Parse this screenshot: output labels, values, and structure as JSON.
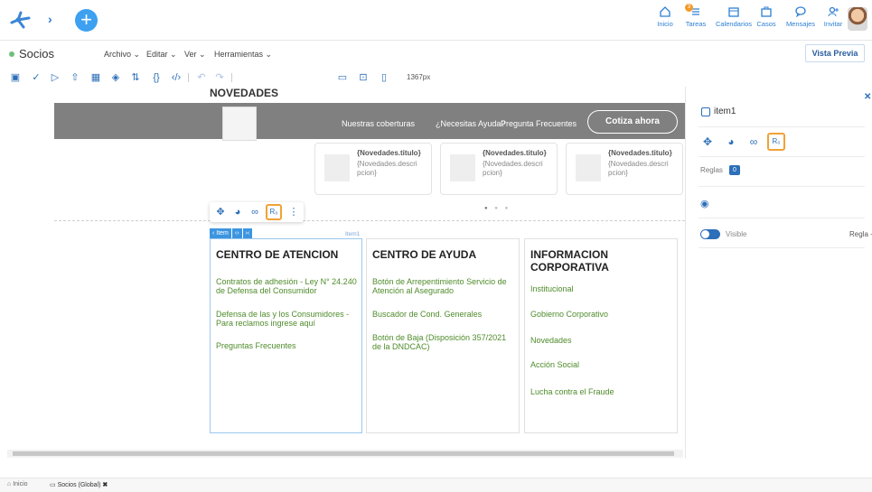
{
  "topnav": {
    "items": [
      {
        "label": "Inicio",
        "icon": "home-icon"
      },
      {
        "label": "Tareas",
        "icon": "tasks-icon",
        "badge": "3"
      },
      {
        "label": "Calendarios",
        "icon": "calendar-icon"
      },
      {
        "label": "Casos",
        "icon": "briefcase-icon"
      },
      {
        "label": "Mensajes",
        "icon": "chat-icon"
      },
      {
        "label": "Invitar",
        "icon": "add-user-icon"
      }
    ]
  },
  "menubar": {
    "title": "Socios",
    "menus": [
      "Archivo ⌄",
      "Editar ⌄",
      "Ver ⌄",
      "Herramientas ⌄"
    ],
    "preview_button": "Vista Previa"
  },
  "toolbar": {
    "width_label": "1367px"
  },
  "canvas": {
    "heading": "NOVEDADES",
    "band_links": [
      "Nuestras coberturas",
      "¿Necesitas Ayuda?",
      "Pregunta Frecuentes"
    ],
    "cta": "Cotiza ahora",
    "cards": [
      {
        "title": "{Novedades.titulo}",
        "desc": "{Novedades.descri pcion}"
      },
      {
        "title": "{Novedades.titulo}",
        "desc": "{Novedades.descri pcion}"
      },
      {
        "title": "{Novedades.titulo}",
        "desc": "{Novedades.descri pcion}"
      }
    ],
    "item_tag": "‹ Item",
    "item_label": "Item1",
    "columns": [
      {
        "title": "CENTRO DE ATENCION",
        "links": [
          "Contratos de adhesión - Ley N° 24.240 de Defensa del Consumidor",
          "Defensa de las y los Consumidores - Para reclamos ingrese aquí",
          "Preguntas Frecuentes"
        ]
      },
      {
        "title": "CENTRO DE AYUDA",
        "links": [
          "Botón de Arrepentimiento Servicio de Atención al Asegurado",
          "Buscador de Cond. Generales",
          "Botón de Baja (Disposición 357/2021 de la DNDCAC)"
        ]
      },
      {
        "title": "INFORMACION CORPORATIVA",
        "links": [
          "Institucional",
          "Gobierno Corporativo",
          "Novedades",
          "Acción Social",
          "Lucha contra el Fraude"
        ]
      }
    ]
  },
  "panel": {
    "item_name": "item1",
    "reglas_label": "Reglas",
    "reglas_count": "0",
    "visible_label": "Visible",
    "regla_label": "Regla +"
  },
  "bottom_tabs": [
    "Inicio",
    "Socios (Global)"
  ],
  "colors": {
    "accent": "#2d6fb8",
    "link_green": "#4f8b2b",
    "highlight_orange": "#f0a238",
    "band_gray": "#6e6e6e"
  }
}
